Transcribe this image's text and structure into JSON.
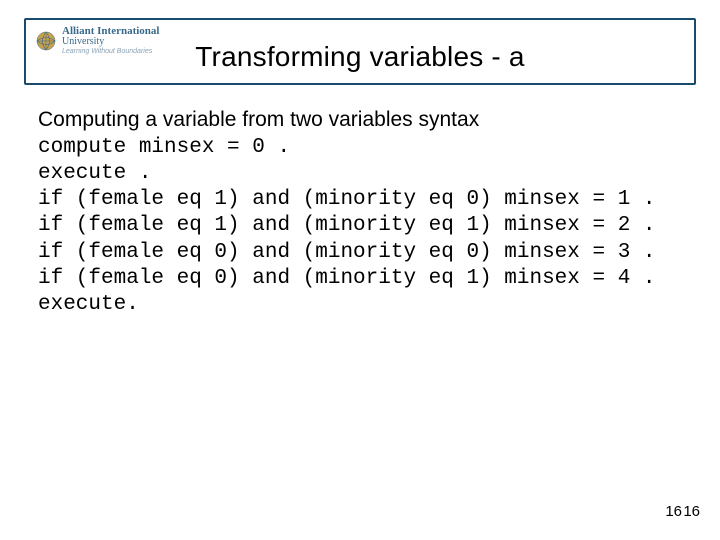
{
  "brand": {
    "name_top": "Alliant International",
    "name_bot": "University",
    "tagline": "Learning Without Boundaries"
  },
  "title": "Transforming variables - a",
  "heading": "Computing a variable from two variables syntax",
  "code_lines": [
    "compute minsex = 0 .",
    "execute .",
    "if (female eq 1) and (minority eq 0) minsex = 1 .",
    "if (female eq 1) and (minority eq 1) minsex = 2 .",
    "if (female eq 0) and (minority eq 0) minsex = 3 .",
    "if (female eq 0) and (minority eq 1) minsex = 4 .",
    "execute."
  ],
  "page_number_left": "16",
  "page_number_right": "16"
}
